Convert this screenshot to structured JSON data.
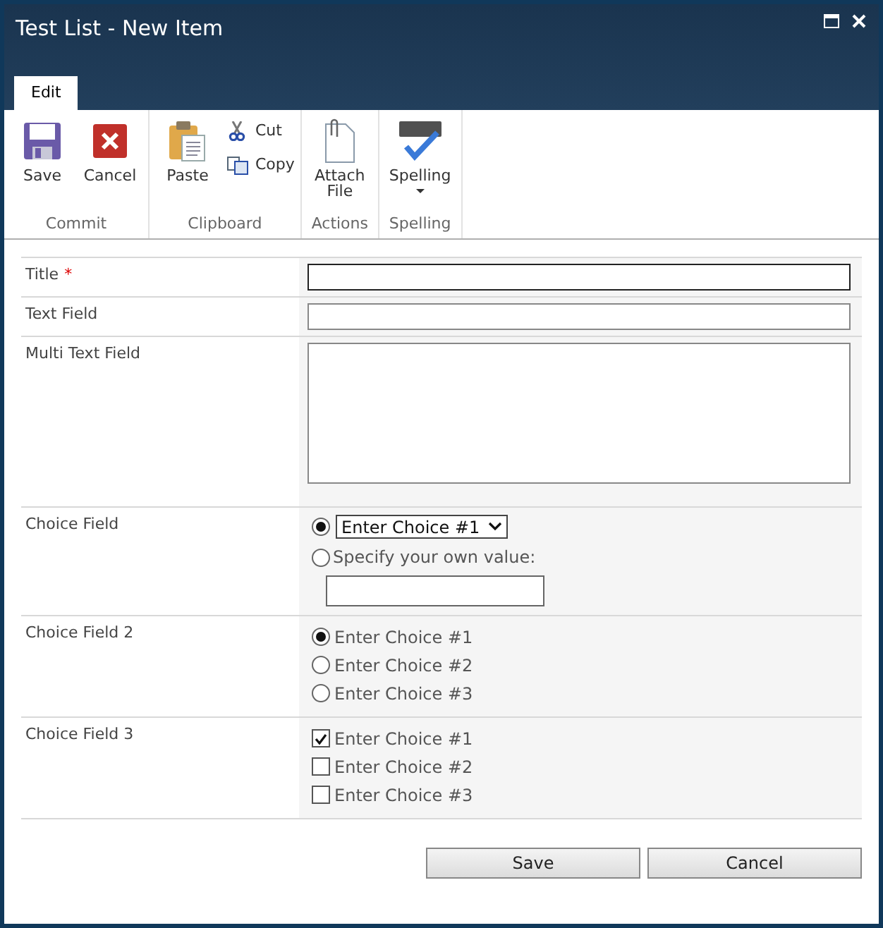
{
  "window": {
    "title": "Test List - New Item"
  },
  "tabs": [
    {
      "label": "Edit",
      "selected": true
    }
  ],
  "ribbon": {
    "groups": [
      {
        "label": "Commit",
        "items": [
          {
            "kind": "large",
            "label": "Save"
          },
          {
            "kind": "large",
            "label": "Cancel"
          }
        ]
      },
      {
        "label": "Clipboard",
        "items": [
          {
            "kind": "large",
            "label": "Paste"
          },
          {
            "kind": "small",
            "label": "Cut"
          },
          {
            "kind": "small",
            "label": "Copy"
          }
        ]
      },
      {
        "label": "Actions",
        "items": [
          {
            "kind": "large",
            "label": "Attach File"
          }
        ]
      },
      {
        "label": "Spelling",
        "items": [
          {
            "kind": "large",
            "label": "Spelling",
            "has_menu": true
          }
        ]
      }
    ]
  },
  "fields": [
    {
      "kind": "text",
      "label": "Title",
      "required_mark": "*",
      "focused": true
    },
    {
      "kind": "text",
      "label": "Text Field",
      "focused": false
    },
    {
      "kind": "textarea",
      "label": "Multi Text Field",
      "focused": false
    },
    {
      "kind": "choice",
      "label": "Choice Field",
      "options": [
        {
          "kind": "dropdown",
          "value": "Enter Choice #1",
          "selected": true
        },
        {
          "kind": "fill_in",
          "label": "Specify your own value:",
          "selected": false
        }
      ]
    },
    {
      "kind": "radio",
      "label": "Choice Field 2",
      "options": [
        {
          "label": "Enter Choice #1",
          "selected": true
        },
        {
          "label": "Enter Choice #2",
          "selected": false
        },
        {
          "label": "Enter Choice #3",
          "selected": false
        }
      ]
    },
    {
      "kind": "checkbox",
      "label": "Choice Field 3",
      "options": [
        {
          "label": "Enter Choice #1",
          "checked": true
        },
        {
          "label": "Enter Choice #2",
          "checked": false
        },
        {
          "label": "Enter Choice #3",
          "checked": false
        }
      ]
    }
  ],
  "buttons": [
    "Save",
    "Cancel"
  ]
}
